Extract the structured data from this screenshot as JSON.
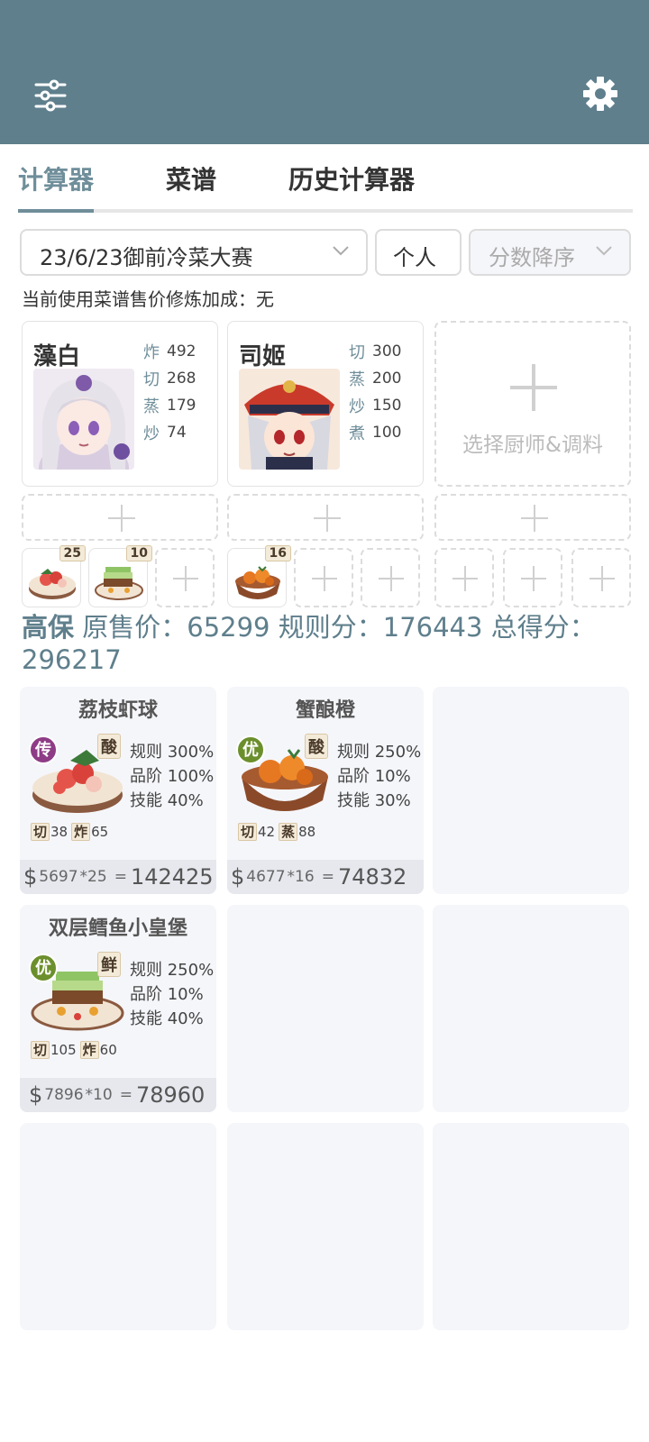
{
  "tabs": [
    "计算器",
    "菜谱",
    "历史计算器"
  ],
  "contest_select": "23/6/23御前冷菜大赛",
  "mode_button": "个人",
  "sort_select": "分数降序",
  "bonus_text": "当前使用菜谱售价修炼加成：无",
  "chefs": [
    {
      "name": "藻白",
      "stats": [
        {
          "k": "炸",
          "v": "492"
        },
        {
          "k": "切",
          "v": "268"
        },
        {
          "k": "蒸",
          "v": "179"
        },
        {
          "k": "炒",
          "v": "74"
        }
      ]
    },
    {
      "name": "司姬",
      "stats": [
        {
          "k": "切",
          "v": "300"
        },
        {
          "k": "蒸",
          "v": "200"
        },
        {
          "k": "炒",
          "v": "150"
        },
        {
          "k": "煮",
          "v": "100"
        }
      ]
    }
  ],
  "add_chef_label": "选择厨师&调料",
  "recipe_slots": [
    {
      "qty": "25"
    },
    {
      "qty": "10"
    },
    {
      "qty": "16"
    }
  ],
  "summary": {
    "grade": "高保",
    "price_label": "原售价：",
    "price": "65299",
    "rule_label": "规则分：",
    "rule": "176443",
    "total_label": "总得分：",
    "total": "296217"
  },
  "dishes": [
    {
      "name": "荔枝虾球",
      "rarity": "传",
      "flavor": "酸",
      "mods": [
        "规则 300%",
        "品阶 100%",
        "技能 40%"
      ],
      "reqs": [
        {
          "k": "切",
          "v": "38"
        },
        {
          "k": "炸",
          "v": "65"
        }
      ],
      "price": "5697",
      "qty": "*25",
      "eq": "=",
      "total": "142425"
    },
    {
      "name": "蟹酿橙",
      "rarity": "优",
      "flavor": "酸",
      "mods": [
        "规则 250%",
        "品阶 10%",
        "技能 30%"
      ],
      "reqs": [
        {
          "k": "切",
          "v": "42"
        },
        {
          "k": "蒸",
          "v": "88"
        }
      ],
      "price": "4677",
      "qty": "*16",
      "eq": "=",
      "total": "74832"
    },
    {
      "name": "双层鳕鱼小皇堡",
      "rarity": "优",
      "flavor": "鲜",
      "mods": [
        "规则 250%",
        "品阶 10%",
        "技能 40%"
      ],
      "reqs": [
        {
          "k": "切",
          "v": "105"
        },
        {
          "k": "炸",
          "v": "60"
        }
      ],
      "price": "7896",
      "qty": "*10",
      "eq": "=",
      "total": "78960"
    }
  ],
  "dollar": "$",
  "colors": {
    "header": "#5f7f8c",
    "accent": "#6f8e9a",
    "card": "#f5f6fa"
  },
  "icons": {
    "menu": "sliders-icon",
    "settings": "gear-icon",
    "dropdown": "chevron-down-icon",
    "add": "plus-icon"
  }
}
